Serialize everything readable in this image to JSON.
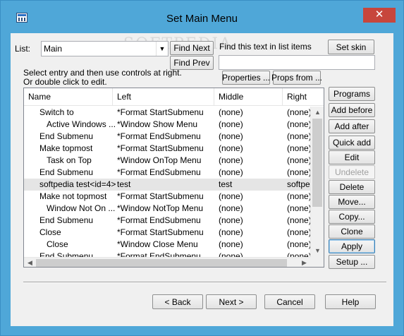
{
  "window": {
    "title": "Set Main Menu",
    "close_glyph": "✕"
  },
  "top": {
    "list_label": "List:",
    "list_value": "Main",
    "find_next": "Find Next",
    "find_prev": "Find Prev",
    "find_label": "Find this text in list items",
    "find_value": "",
    "set_skin": "Set skin",
    "instructions_1": "Select entry and then use controls at right.",
    "instructions_2": "Or double click to edit.",
    "properties": "Properties ...",
    "props_from": "Props from ...",
    "watermark": "SOFTPEDIA"
  },
  "list": {
    "columns": [
      "Name",
      "Left",
      "Middle",
      "Right"
    ],
    "rows": [
      {
        "name": "Switch to",
        "indent": 1,
        "left": "*Format StartSubmenu",
        "middle": "(none)",
        "right": "(none)"
      },
      {
        "name": "Active Windows ...",
        "indent": 2,
        "left": "*Window Show Menu",
        "middle": "(none)",
        "right": "(none)"
      },
      {
        "name": "End Submenu",
        "indent": 1,
        "left": "*Format EndSubmenu",
        "middle": "(none)",
        "right": "(none)"
      },
      {
        "name": "Make topmost",
        "indent": 1,
        "left": "*Format StartSubmenu",
        "middle": "(none)",
        "right": "(none)"
      },
      {
        "name": "Task on Top",
        "indent": 2,
        "left": "*Window OnTop Menu",
        "middle": "(none)",
        "right": "(none)"
      },
      {
        "name": "End Submenu",
        "indent": 1,
        "left": "*Format EndSubmenu",
        "middle": "(none)",
        "right": "(none)"
      },
      {
        "name": "softpedia test<id=4>",
        "indent": 1,
        "left": "test",
        "middle": "test",
        "right": "softpedi",
        "selected": true
      },
      {
        "name": "Make not topmost",
        "indent": 1,
        "left": "*Format StartSubmenu",
        "middle": "(none)",
        "right": "(none)"
      },
      {
        "name": "Window Not On ...",
        "indent": 2,
        "left": "*Window NotTop Menu",
        "middle": "(none)",
        "right": "(none)"
      },
      {
        "name": "End Submenu",
        "indent": 1,
        "left": "*Format EndSubmenu",
        "middle": "(none)",
        "right": "(none)"
      },
      {
        "name": "Close",
        "indent": 1,
        "left": "*Format StartSubmenu",
        "middle": "(none)",
        "right": "(none)"
      },
      {
        "name": "Close",
        "indent": 2,
        "left": "*Window Close Menu",
        "middle": "(none)",
        "right": "(none)"
      },
      {
        "name": "End Submenu",
        "indent": 1,
        "left": "*Format EndSubmenu",
        "middle": "(none)",
        "right": "(none)"
      }
    ]
  },
  "side_buttons": {
    "programs": "Programs",
    "add_before": "Add before",
    "add_after": "Add after",
    "quick_add": "Quick add",
    "edit": "Edit",
    "undelete": "Undelete",
    "delete": "Delete",
    "move": "Move...",
    "copy": "Copy...",
    "clone": "Clone",
    "apply": "Apply",
    "setup": "Setup ..."
  },
  "footer": {
    "back": "< Back",
    "next": "Next >",
    "cancel": "Cancel",
    "help": "Help"
  },
  "colors": {
    "title_bar": "#4fa7d8",
    "close_button": "#c7463c",
    "selected_row": "#e5e5e5"
  }
}
